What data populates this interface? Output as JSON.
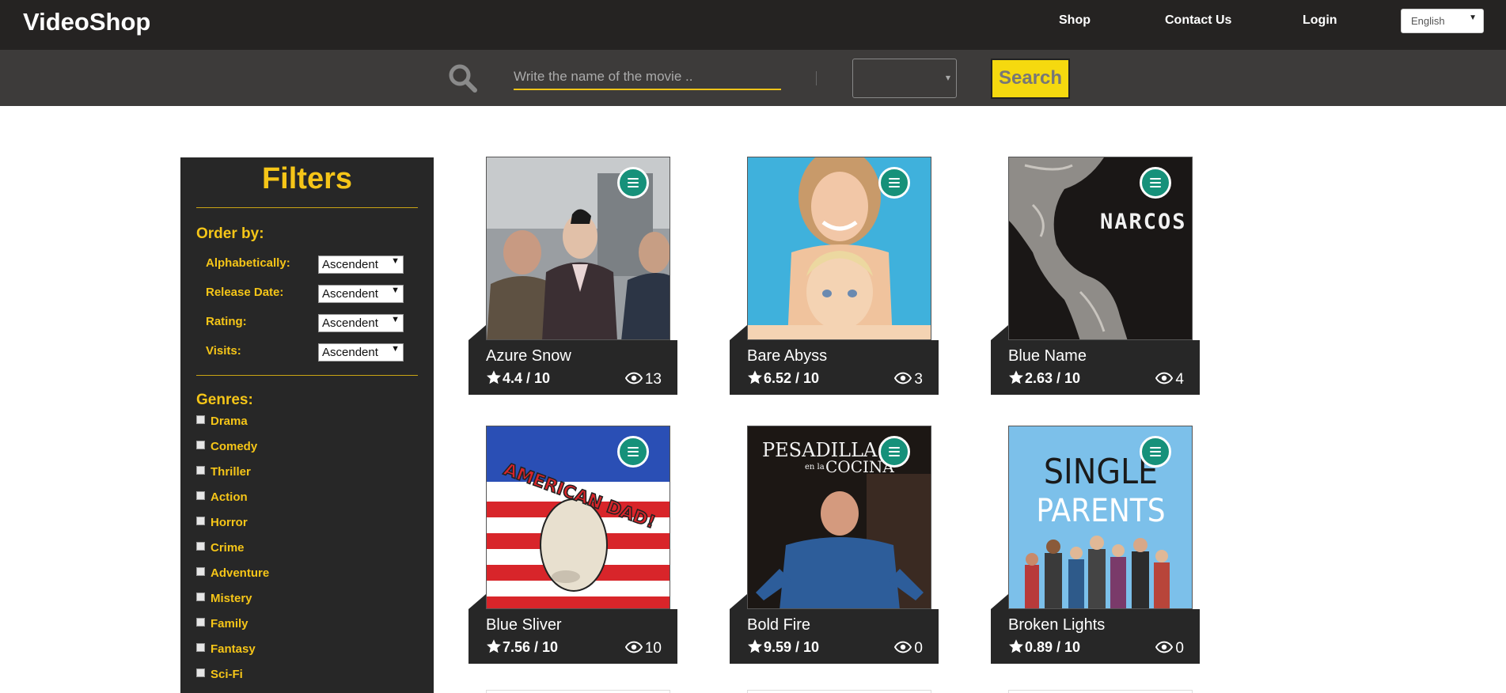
{
  "header": {
    "brand": "VideoShop",
    "nav": [
      "Shop",
      "Contact Us",
      "Login"
    ],
    "language": "English"
  },
  "search": {
    "placeholder": "Write the name of the movie ..",
    "category_value": "",
    "button_label": "Search"
  },
  "filters": {
    "title": "Filters",
    "order_title": "Order by:",
    "order": [
      {
        "label": "Alphabetically:",
        "value": "Ascendent"
      },
      {
        "label": "Release Date:",
        "value": "Ascendent"
      },
      {
        "label": "Rating:",
        "value": "Ascendent"
      },
      {
        "label": "Visits:",
        "value": "Ascendent"
      }
    ],
    "genres_title": "Genres:",
    "genres": [
      "Drama",
      "Comedy",
      "Thriller",
      "Action",
      "Horror",
      "Crime",
      "Adventure",
      "Mistery",
      "Family",
      "Fantasy",
      "Sci-Fi"
    ]
  },
  "movies": [
    {
      "title": "Azure Snow",
      "rating": "4.4 / 10",
      "views": "13"
    },
    {
      "title": "Bare Abyss",
      "rating": "6.52 / 10",
      "views": "3"
    },
    {
      "title": "Blue Name",
      "rating": "2.63 / 10",
      "views": "4"
    },
    {
      "title": "Blue Sliver",
      "rating": "7.56 / 10",
      "views": "10"
    },
    {
      "title": "Bold Fire",
      "rating": "9.59 / 10",
      "views": "0"
    },
    {
      "title": "Broken Lights",
      "rating": "0.89 / 10",
      "views": "0"
    }
  ],
  "posters": {
    "narcos_text": "NARCOS",
    "american_dad_text": "AMERICAN DAD!",
    "pesadilla_line1": "PESADILLA",
    "pesadilla_line2": "en la",
    "pesadilla_line3": "COCINA",
    "single_parents_line1": "SINGLE",
    "single_parents_line2": "PARENTS"
  },
  "colors": {
    "accent_yellow": "#f5c518",
    "dark": "#272727",
    "menu_green": "#16917a"
  }
}
